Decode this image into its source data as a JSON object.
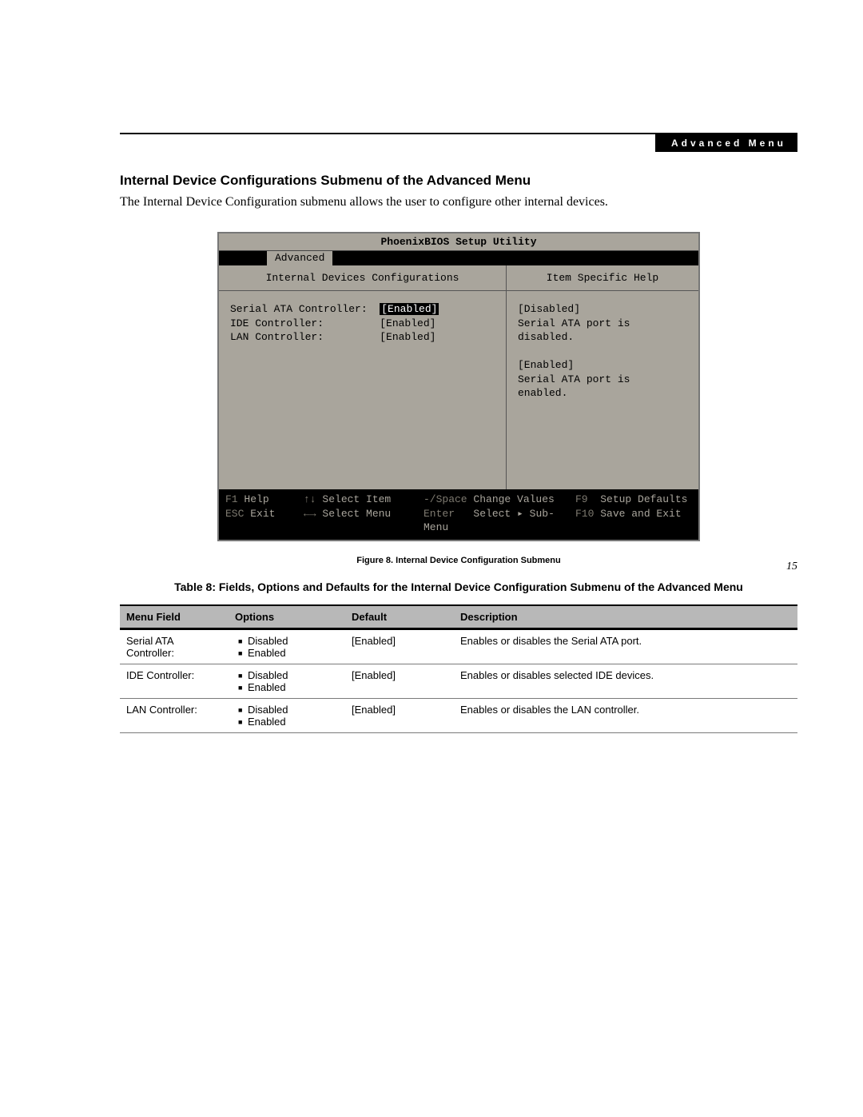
{
  "header": {
    "badge": "Advanced Menu"
  },
  "section_heading": "Internal Device Configurations Submenu of the Advanced Menu",
  "intro": "The Internal Device Configuration submenu allows the user to configure other internal devices.",
  "bios": {
    "title": "PhoenixBIOS Setup Utility",
    "tab": "Advanced",
    "left_heading": "Internal Devices Configurations",
    "right_heading": "Item Specific Help",
    "settings": [
      {
        "label": "Serial ATA Controller:",
        "value": "[Enabled]",
        "selected": true
      },
      {
        "label": "IDE Controller:",
        "value": "[Enabled]",
        "selected": false
      },
      {
        "label": "LAN Controller:",
        "value": "[Enabled]",
        "selected": false
      }
    ],
    "help_lines": [
      "[Disabled]",
      "Serial ATA port is",
      "disabled.",
      "",
      "[Enabled]",
      "Serial ATA port is",
      "enabled."
    ],
    "footer": {
      "f1": "F1",
      "help": "Help",
      "select_item": "Select Item",
      "change_key": "-/Space",
      "change_values": "Change Values",
      "f9": "F9",
      "setup_defaults": "Setup Defaults",
      "esc": "ESC",
      "exit": "Exit",
      "select_menu": "Select Menu",
      "enter": "Enter",
      "select_sub": "Select ▸ Sub-Menu",
      "f10": "F10",
      "save_exit": "Save and Exit"
    }
  },
  "figure_caption": "Figure 8.  Internal Device Configuration Submenu",
  "table_caption": "Table 8: Fields, Options and Defaults for the Internal Device Configuration Submenu of the Advanced Menu",
  "table": {
    "headers": [
      "Menu Field",
      "Options",
      "Default",
      "Description"
    ],
    "rows": [
      {
        "field": "Serial ATA Controller:",
        "options": [
          "Disabled",
          "Enabled"
        ],
        "default": "[Enabled]",
        "desc": "Enables or disables the Serial ATA port."
      },
      {
        "field": "IDE Controller:",
        "options": [
          "Disabled",
          "Enabled"
        ],
        "default": "[Enabled]",
        "desc": "Enables or disables selected IDE devices."
      },
      {
        "field": "LAN Controller:",
        "options": [
          "Disabled",
          "Enabled"
        ],
        "default": "[Enabled]",
        "desc": "Enables or disables the LAN controller."
      }
    ]
  },
  "page_number": "15"
}
